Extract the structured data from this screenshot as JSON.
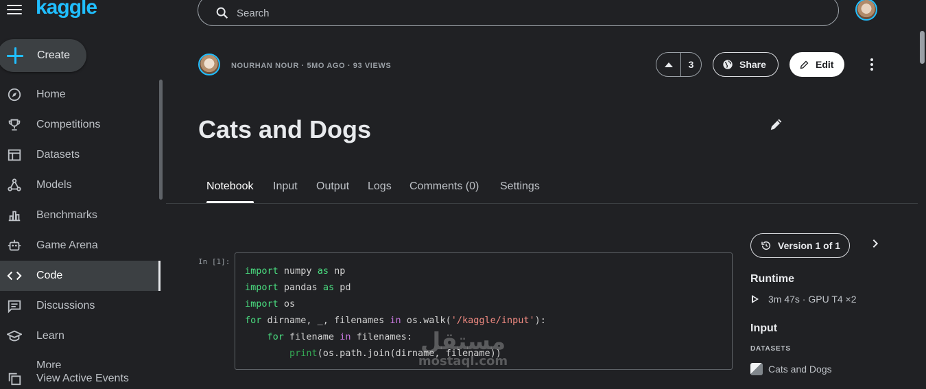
{
  "app": {
    "logo": "kaggle"
  },
  "sidebar": {
    "create_label": "Create",
    "items": [
      {
        "label": "Home",
        "icon": "compass-icon"
      },
      {
        "label": "Competitions",
        "icon": "trophy-icon"
      },
      {
        "label": "Datasets",
        "icon": "table-icon"
      },
      {
        "label": "Models",
        "icon": "models-icon"
      },
      {
        "label": "Benchmarks",
        "icon": "bar-chart-icon"
      },
      {
        "label": "Game Arena",
        "icon": "robot-icon"
      },
      {
        "label": "Code",
        "icon": "code-icon",
        "active": true
      },
      {
        "label": "Discussions",
        "icon": "comment-icon"
      },
      {
        "label": "Learn",
        "icon": "school-icon"
      }
    ],
    "more_label": "More",
    "active_events_label": "View Active Events"
  },
  "search": {
    "placeholder": "Search"
  },
  "notebook": {
    "meta": "NOURHAN NOUR · 5MO AGO · 93 VIEWS",
    "votes": "3",
    "share_label": "Share",
    "edit_label": "Edit",
    "title": "Cats and Dogs"
  },
  "tabs": [
    {
      "label": "Notebook",
      "active": true
    },
    {
      "label": "Input"
    },
    {
      "label": "Output"
    },
    {
      "label": "Logs"
    },
    {
      "label": "Comments (0)"
    },
    {
      "label": "Settings"
    }
  ],
  "cell": {
    "prompt": "In [1]:",
    "lines": [
      "import numpy as np",
      "import pandas as pd",
      "import os",
      "for dirname, _, filenames in os.walk('/kaggle/input'):",
      "    for filename in filenames:",
      "        print(os.path.join(dirname, filename))"
    ]
  },
  "right_panel": {
    "version_label": "Version 1 of 1",
    "runtime_heading": "Runtime",
    "runtime_value": "3m 47s · GPU T4 ×2",
    "input_heading": "Input",
    "datasets_label": "DATASETS",
    "dataset_name": "Cats and Dogs"
  },
  "watermark": {
    "arabic": "مستقل",
    "latin": "mostaql.com"
  },
  "colors": {
    "accent": "#20beff",
    "background": "#202124",
    "surface": "#3c4043"
  }
}
